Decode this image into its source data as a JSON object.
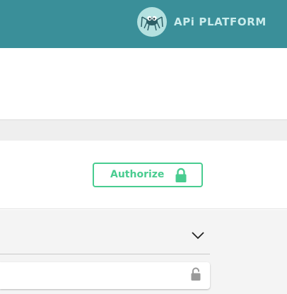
{
  "header": {
    "brand_text": "APi PLATFORM",
    "logo_icon": "spider-logo-icon",
    "background_color": "#3a8f99"
  },
  "scheme_container": {
    "authorize_label": "Authorize",
    "authorize_icon": "lock-icon",
    "accent_color": "#49cc90"
  },
  "operations": {
    "tag_expand_icon": "chevron-down-icon",
    "operation_lock_icon": "unlocked-lock-icon"
  }
}
